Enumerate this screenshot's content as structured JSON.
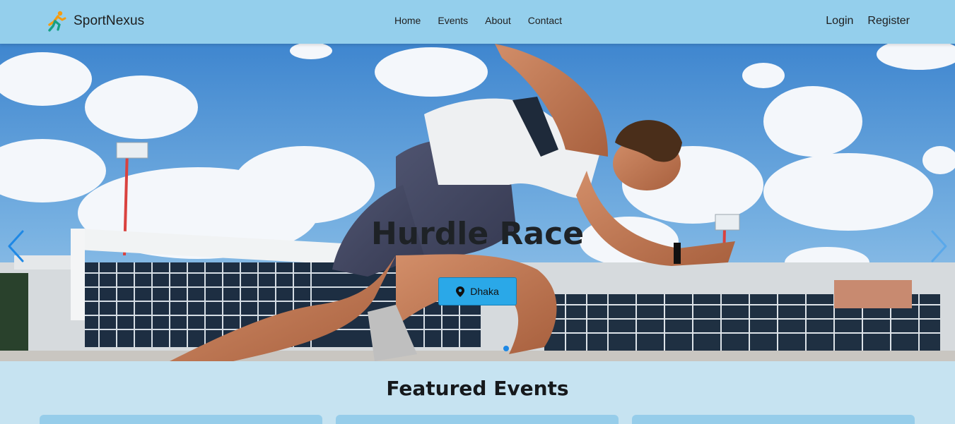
{
  "navbar": {
    "brand": "SportNexus",
    "logo_icon": "runner-logo-icon",
    "links": [
      "Home",
      "Events",
      "About",
      "Contact"
    ],
    "auth": [
      "Login",
      "Register"
    ]
  },
  "hero": {
    "title": "Hurdle Race",
    "location_icon": "map-pin-icon",
    "location": "Dhaka",
    "prev_icon": "chevron-left-icon",
    "next_icon": "chevron-right-icon",
    "slide_count": 1,
    "active_slide": 1
  },
  "featured": {
    "title": "Featured Events"
  },
  "colors": {
    "navbar_bg": "#94cfec",
    "page_bg": "#c6e3f1",
    "button_bg": "#2aa8e8",
    "control_blue": "#1e88e5"
  }
}
